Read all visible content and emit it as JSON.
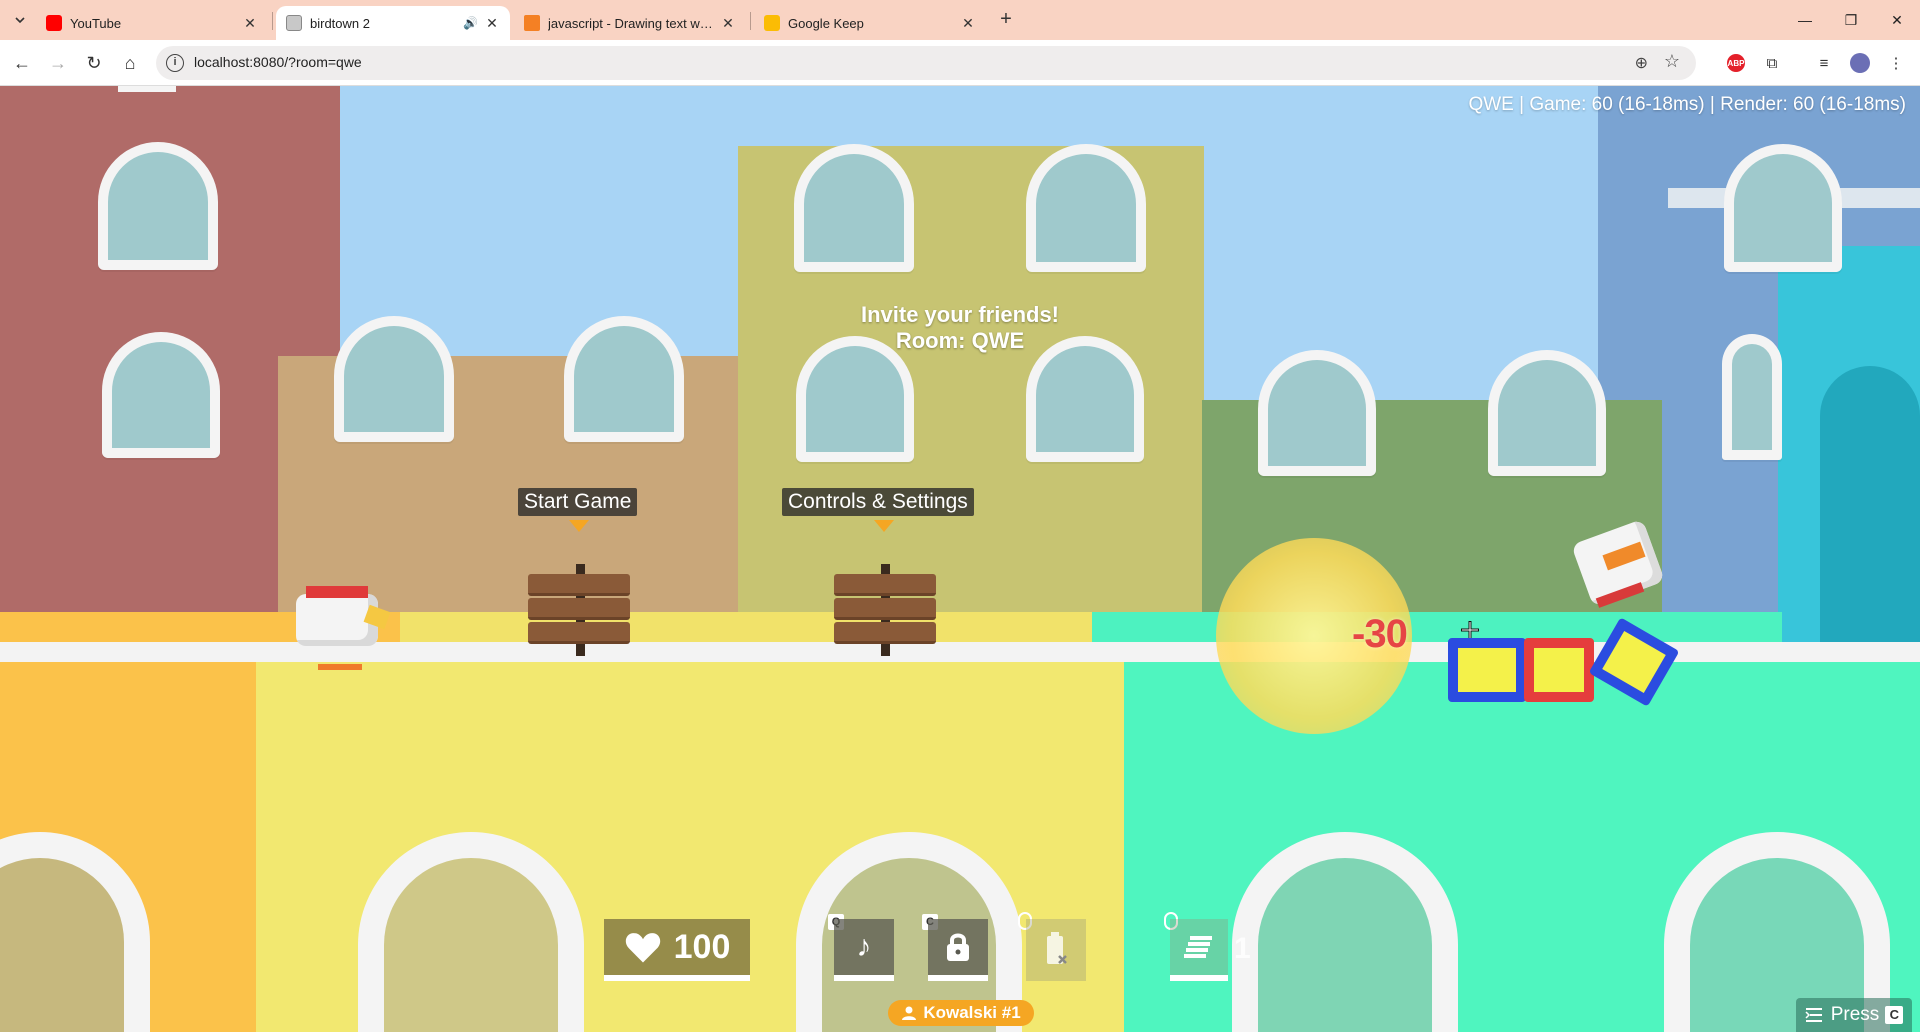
{
  "browser": {
    "tabs": [
      {
        "title": "YouTube",
        "favicon": "youtube-icon",
        "active": false
      },
      {
        "title": "birdtown 2",
        "favicon": "birdtown-icon",
        "active": true
      },
      {
        "title": "javascript - Drawing text with a",
        "favicon": "stackoverflow-icon",
        "active": false
      },
      {
        "title": "Google Keep",
        "favicon": "google-keep-icon",
        "active": false
      }
    ],
    "url": "localhost:8080/?room=qwe"
  },
  "game": {
    "stats": "QWE | Game: 60 (16-18ms) | Render: 60 (16-18ms)",
    "invite": {
      "line1": "Invite your friends!",
      "line2": "Room: QWE"
    },
    "signs": [
      {
        "label": "Start Game"
      },
      {
        "label": "Controls & Settings"
      }
    ],
    "damage_text": "-30",
    "hud": {
      "health": "100",
      "health_icon": "heart-icon",
      "music_key": "Q",
      "lock_key": "C",
      "ammo_count": "1",
      "player_name": "Kowalski #1",
      "press_label": "Press",
      "press_key": "C"
    },
    "colors": {
      "sky": "#a8d4f5",
      "accent": "#f5a623",
      "damage": "#e64545"
    }
  }
}
